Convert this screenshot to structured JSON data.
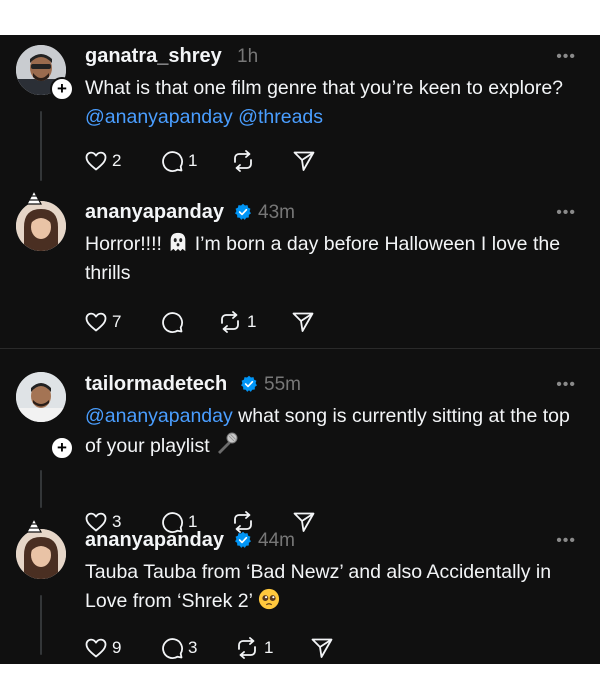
{
  "posts": [
    {
      "username": "ganatra_shrey",
      "time": "1h",
      "verified": false,
      "text_parts": [
        "What is that one film genre that you’re keen to explore? ",
        "@ananyapanday",
        " ",
        "@threads"
      ],
      "likes": "2",
      "replies": "1",
      "reposts": ""
    },
    {
      "username": "ananyapanday",
      "time": "43m",
      "verified": true,
      "text_parts": [
        "Horror!!!! ",
        " I’m born a day before Halloween I love the thrills"
      ],
      "emoji": "ghost-emoji",
      "likes": "7",
      "replies": "",
      "reposts": "1"
    },
    {
      "username": "tailormadetech",
      "time": "55m",
      "verified": true,
      "text_parts": [
        "@ananyapanday",
        " what song is currently sitting at the top of your playlist "
      ],
      "emoji": "microphone-emoji",
      "likes": "3",
      "replies": "1",
      "reposts": ""
    },
    {
      "username": "ananyapanday",
      "time": "44m",
      "verified": true,
      "text_parts": [
        "Tauba Tauba from ‘Bad Newz’ and also Accidentally in Love from ‘Shrek 2’ "
      ],
      "emoji": "pleading-face-emoji",
      "likes": "9",
      "replies": "3",
      "reposts": "1"
    }
  ],
  "colors": {
    "background": "#101010",
    "text": "#f3f5f7",
    "muted": "#777777",
    "mention": "#4a9eff",
    "verified": "#0095f6"
  }
}
